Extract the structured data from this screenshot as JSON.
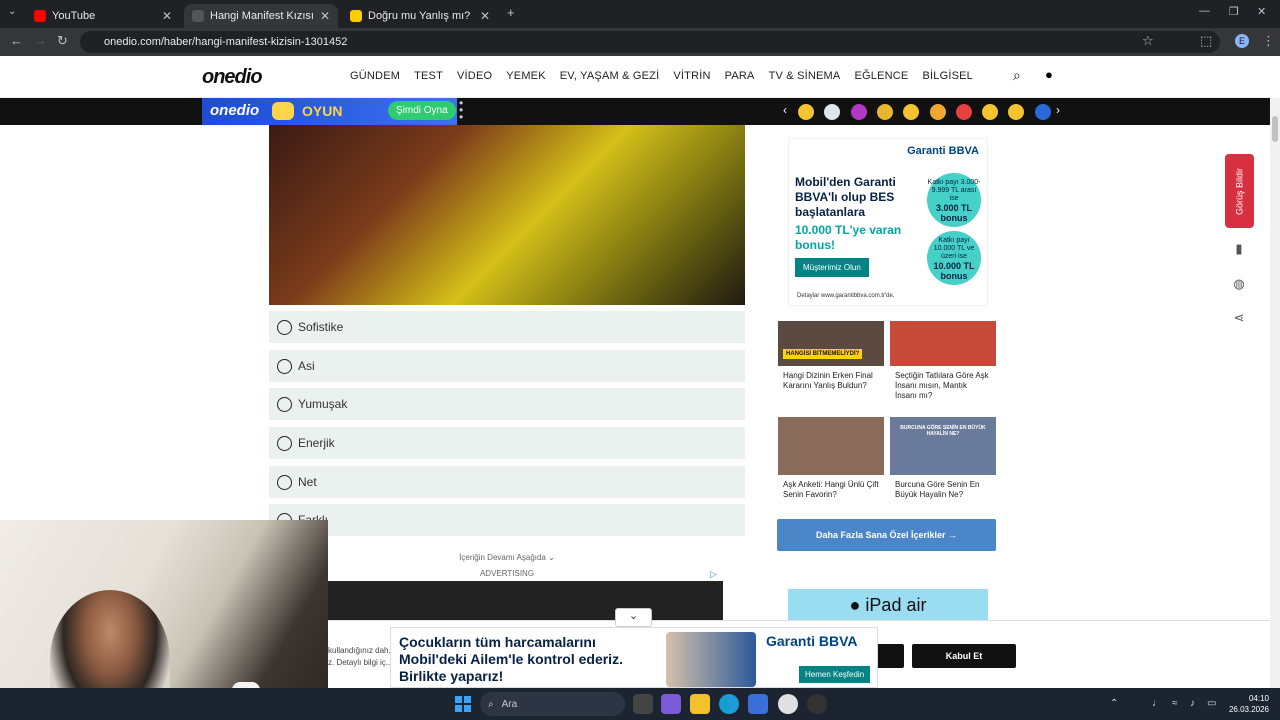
{
  "browser": {
    "tabs": [
      {
        "title": "YouTube",
        "active": false,
        "favicon_color": "#ff0000"
      },
      {
        "title": "Hangi Manifest Kızısın? - Oned",
        "active": true,
        "favicon_color": "#111111"
      },
      {
        "title": "Doğru mu Yanlış mı? Genel Kül",
        "active": false,
        "favicon_color": "#ffcc00"
      }
    ],
    "new_tab": "+",
    "url": "onedio.com/haber/hangi-manifest-kizisin-1301452",
    "profile_letter": "E"
  },
  "site": {
    "logo": "onedio",
    "nav": [
      "GÜNDEM",
      "TEST",
      "VİDEO",
      "YEMEK",
      "EV, YAŞAM & GEZİ",
      "VİTRİN",
      "PARA",
      "TV & SİNEMA",
      "EĞLENCE",
      "BİLGİSEL"
    ],
    "oyun_logo": "onedio",
    "oyun_label": "OYUN",
    "oyun_button": "Şimdi Oyna",
    "emoji_colors": [
      "#f4c430",
      "#dde6f0",
      "#b23ac2",
      "#e8b62c",
      "#f4c430",
      "#f0a830",
      "#e84040",
      "#f4c430",
      "#f4c430",
      "#2a6ad8"
    ]
  },
  "quiz": {
    "options": [
      "Sofistike",
      "Asi",
      "Yumuşak",
      "Enerjik",
      "Net",
      "Farklı"
    ],
    "continue_note": "İçeriğin Devamı Aşağıda",
    "ad_label": "ADVERTISING"
  },
  "right_ad": {
    "brand": "Garanti BBVA",
    "headline": "Mobil'den Garanti BBVA'lı olup BES başlatanlara",
    "subline": "10.000 TL'ye varan bonus!",
    "circle1": {
      "small": "Katkı payı 3.000-9.999 TL arası ise",
      "big": "3.000 TL bonus"
    },
    "circle2": {
      "small": "Katkı payı 10.000 TL ve üzeri ise",
      "big": "10.000 TL bonus"
    },
    "button": "Müşterimiz Olun",
    "details": "Detaylar www.garantibbva.com.tr'de."
  },
  "cards": [
    {
      "title": "Hangi Dizinin Erken Final Kararını Yanlış Buldun?",
      "badge": "HANGİSİ BİTMEMELİYDİ?",
      "color": "#5a4a40"
    },
    {
      "title": "Seçtiğin Tatlılara Göre Aşk İnsanı mısın, Mantık İnsanı mı?",
      "badge": "",
      "color": "#c64a3a"
    },
    {
      "title": "Aşk Anketi: Hangi Ünlü Çift Senin Favorin?",
      "badge": "",
      "color": "#8a6a5a"
    },
    {
      "title": "Burcuna Göre Senin En Büyük Hayalin Ne?",
      "badge": "BURCUNA GÖRE SENİN EN BÜYÜK HAYALİN NE?",
      "color": "#6a7a9a"
    }
  ],
  "more_button": "Daha Fazla Sana Özel İçerikler  →",
  "ipad_ad": "iPad air",
  "feedback": "Görüş Bildir",
  "bottom_ad": {
    "text": "Çocukların tüm harcamalarını Mobil'deki Ailem'le kontrol ederiz. Birlikte yaparız!",
    "brand": "Garanti BBVA",
    "button": "Hemen Keşfedin",
    "collapse": "⌄"
  },
  "cookie": {
    "text_fragment": "kullandığınız dah... z. Detaylı bilgi iç...",
    "accept": "Kabul Et",
    "other": ""
  },
  "taskbar": {
    "search_placeholder": "Ara",
    "time": "04:10",
    "date": "26.03.2026"
  }
}
